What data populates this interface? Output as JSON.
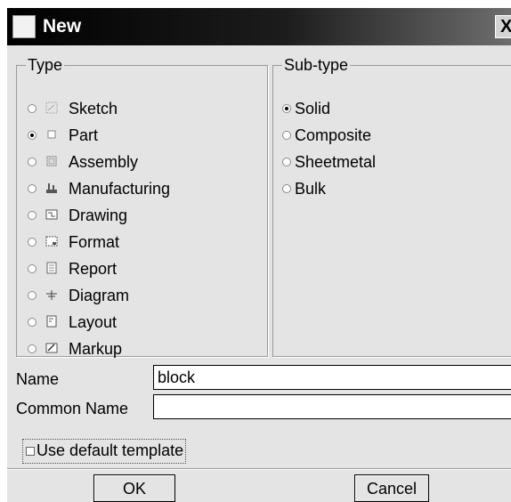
{
  "window": {
    "title": "New",
    "close_label": "X"
  },
  "type_group": {
    "legend": "Type",
    "options": [
      {
        "label": "Sketch",
        "icon": "sketch-icon",
        "selected": false
      },
      {
        "label": "Part",
        "icon": "part-icon",
        "selected": true
      },
      {
        "label": "Assembly",
        "icon": "assembly-icon",
        "selected": false
      },
      {
        "label": "Manufacturing",
        "icon": "manufacturing-icon",
        "selected": false
      },
      {
        "label": "Drawing",
        "icon": "drawing-icon",
        "selected": false
      },
      {
        "label": "Format",
        "icon": "format-icon",
        "selected": false
      },
      {
        "label": "Report",
        "icon": "report-icon",
        "selected": false
      },
      {
        "label": "Diagram",
        "icon": "diagram-icon",
        "selected": false
      },
      {
        "label": "Layout",
        "icon": "layout-icon",
        "selected": false
      },
      {
        "label": "Markup",
        "icon": "markup-icon",
        "selected": false
      }
    ]
  },
  "subtype_group": {
    "legend": "Sub-type",
    "options": [
      {
        "label": "Solid",
        "selected": true
      },
      {
        "label": "Composite",
        "selected": false
      },
      {
        "label": "Sheetmetal",
        "selected": false
      },
      {
        "label": "Bulk",
        "selected": false
      }
    ]
  },
  "name_field": {
    "label": "Name",
    "value": "block"
  },
  "common_name_field": {
    "label": "Common Name",
    "value": ""
  },
  "use_default_template": {
    "label": "Use default template",
    "checked": false
  },
  "buttons": {
    "ok": "OK",
    "cancel": "Cancel"
  },
  "colors": {
    "dialog_bg": "#e4e4e4",
    "titlebar_dark": "#000000",
    "titlebar_light": "#6e6e6e"
  }
}
